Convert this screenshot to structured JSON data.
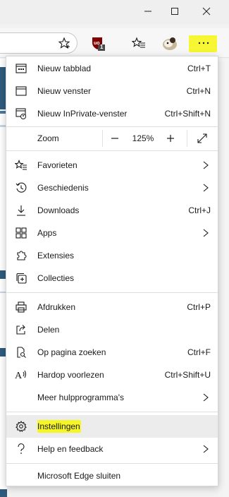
{
  "window_controls": {
    "minimize": "minimize",
    "maximize": "maximize",
    "close": "close"
  },
  "toolbar": {
    "extension_badge": "1",
    "icons": [
      "favorite-star-icon",
      "extension-ublock-icon",
      "favorites-list-icon",
      "profile-avatar-icon",
      "more-dots-icon"
    ]
  },
  "menu": {
    "group1": [
      {
        "label": "Nieuw tabblad",
        "shortcut": "Ctrl+T"
      },
      {
        "label": "Nieuw venster",
        "shortcut": "Ctrl+N"
      },
      {
        "label": "Nieuw InPrivate-venster",
        "shortcut": "Ctrl+Shift+N"
      }
    ],
    "zoom": {
      "label": "Zoom",
      "minus": "—",
      "value": "125%",
      "plus": "+"
    },
    "group2": [
      {
        "label": "Favorieten"
      },
      {
        "label": "Geschiedenis"
      },
      {
        "label": "Downloads",
        "shortcut": "Ctrl+J"
      },
      {
        "label": "Apps"
      },
      {
        "label": "Extensies"
      },
      {
        "label": "Collecties"
      }
    ],
    "group3": [
      {
        "label": "Afdrukken",
        "shortcut": "Ctrl+P"
      },
      {
        "label": "Delen"
      },
      {
        "label": "Op pagina zoeken",
        "shortcut": "Ctrl+F"
      },
      {
        "label": "Hardop voorlezen",
        "shortcut": "Ctrl+Shift+U"
      },
      {
        "label": "Meer hulpprogramma's"
      }
    ],
    "group4": [
      {
        "label": "Instellingen"
      },
      {
        "label": "Help en feedback"
      }
    ],
    "close": {
      "label": "Microsoft Edge sluiten"
    }
  },
  "colors": {
    "highlight": "#f5f51e",
    "menu_bg": "#ffffff",
    "hover": "#ececec"
  }
}
